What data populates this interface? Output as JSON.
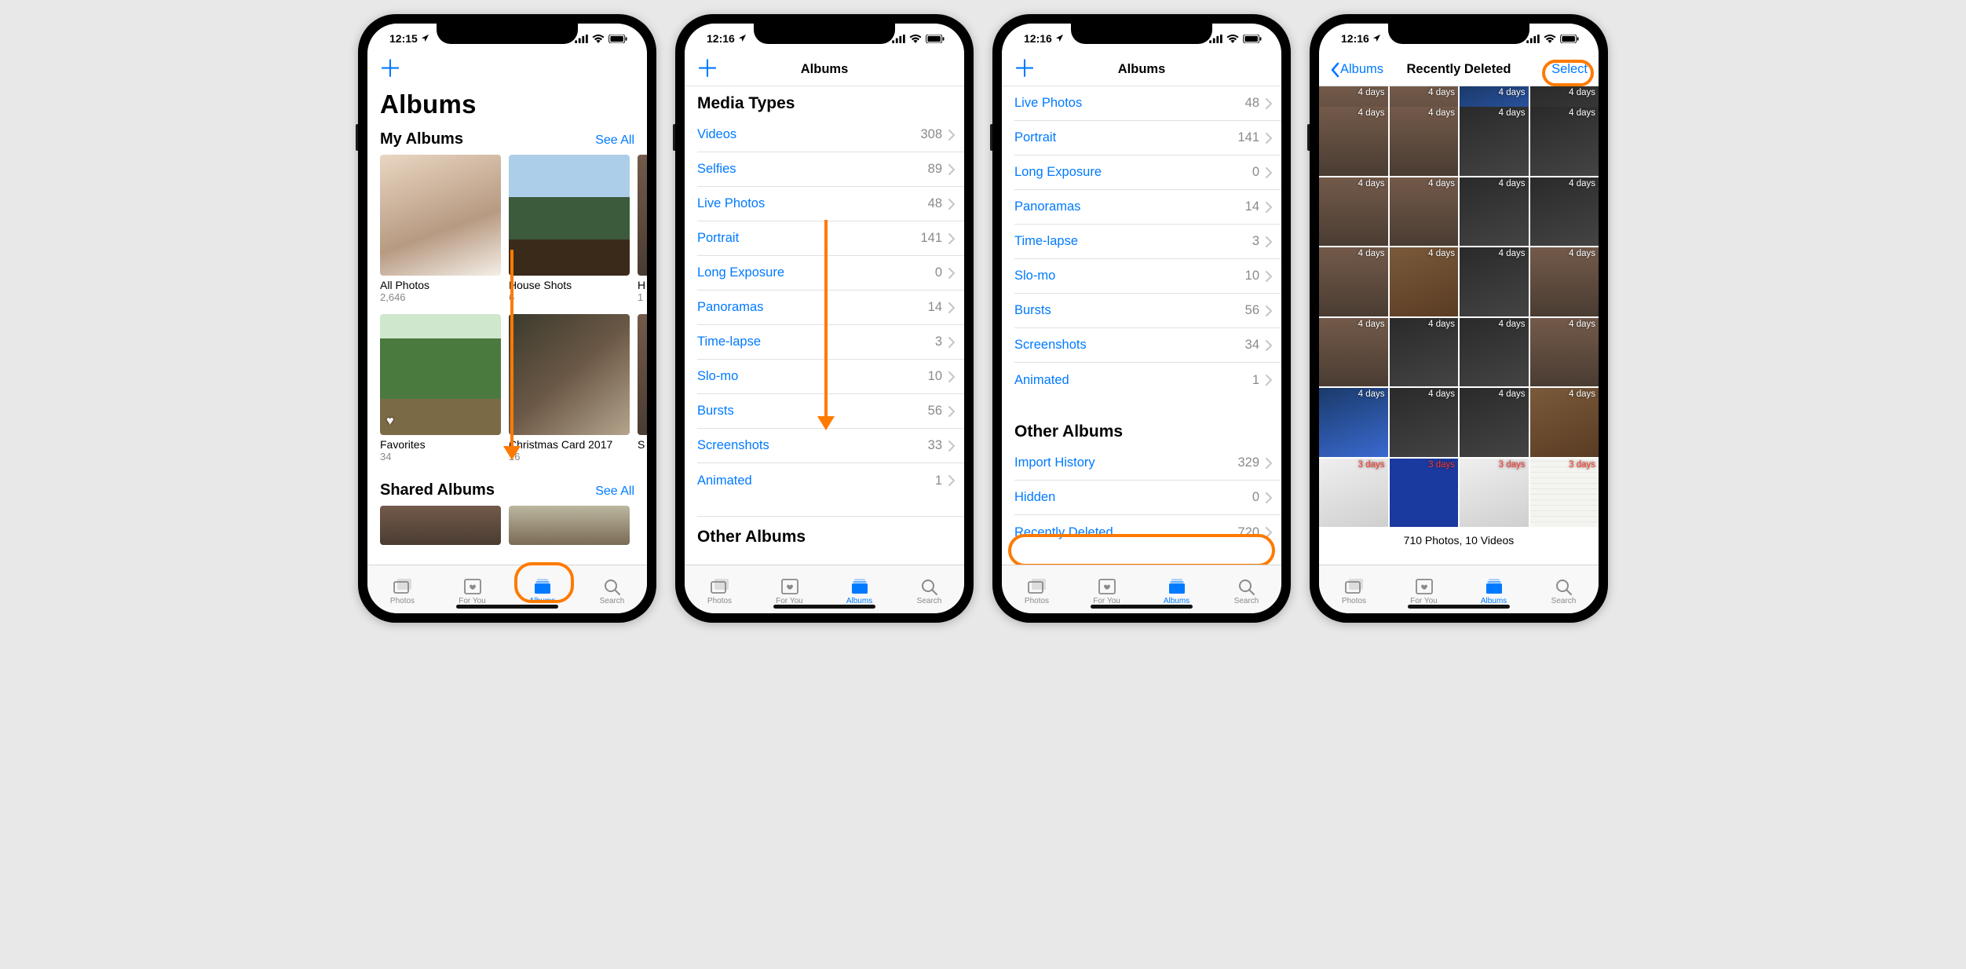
{
  "statusbar": {
    "t1": "12:15",
    "t2": "12:16",
    "t3": "12:16",
    "t4": "12:16"
  },
  "screen1": {
    "add": "＋",
    "large_title": "Albums",
    "my_albums_title": "My Albums",
    "see_all": "See All",
    "albums": [
      {
        "name": "All Photos",
        "count": "2,646"
      },
      {
        "name": "House Shots",
        "count": "6"
      },
      {
        "name": "H",
        "count": "1"
      }
    ],
    "albums2": [
      {
        "name": "Favorites",
        "count": "34"
      },
      {
        "name": "Christmas Card 2017",
        "count": "16"
      },
      {
        "name": "S",
        "count": ""
      }
    ],
    "shared_title": "Shared Albums"
  },
  "screen2": {
    "nav_title": "Albums",
    "section_title": "Media Types",
    "rows": [
      {
        "label": "Videos",
        "count": "308"
      },
      {
        "label": "Selfies",
        "count": "89"
      },
      {
        "label": "Live Photos",
        "count": "48"
      },
      {
        "label": "Portrait",
        "count": "141"
      },
      {
        "label": "Long Exposure",
        "count": "0"
      },
      {
        "label": "Panoramas",
        "count": "14"
      },
      {
        "label": "Time-lapse",
        "count": "3"
      },
      {
        "label": "Slo-mo",
        "count": "10"
      },
      {
        "label": "Bursts",
        "count": "56"
      },
      {
        "label": "Screenshots",
        "count": "33"
      },
      {
        "label": "Animated",
        "count": "1"
      }
    ],
    "other_title": "Other Albums"
  },
  "screen3": {
    "nav_title": "Albums",
    "rows": [
      {
        "label": "Live Photos",
        "count": "48"
      },
      {
        "label": "Portrait",
        "count": "141"
      },
      {
        "label": "Long Exposure",
        "count": "0"
      },
      {
        "label": "Panoramas",
        "count": "14"
      },
      {
        "label": "Time-lapse",
        "count": "3"
      },
      {
        "label": "Slo-mo",
        "count": "10"
      },
      {
        "label": "Bursts",
        "count": "56"
      },
      {
        "label": "Screenshots",
        "count": "34"
      },
      {
        "label": "Animated",
        "count": "1"
      }
    ],
    "other_title": "Other Albums",
    "other_rows": [
      {
        "label": "Import History",
        "count": "329"
      },
      {
        "label": "Hidden",
        "count": "0"
      },
      {
        "label": "Recently Deleted",
        "count": "720"
      }
    ]
  },
  "screen4": {
    "back": "Albums",
    "title": "Recently Deleted",
    "select": "Select",
    "summary": "710 Photos, 10 Videos",
    "day_tag": "4 days",
    "day_tag3": "3 days"
  },
  "tabs": {
    "photos": "Photos",
    "foryou": "For You",
    "albums": "Albums",
    "search": "Search"
  }
}
